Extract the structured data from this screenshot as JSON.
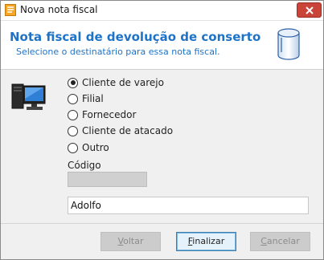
{
  "window": {
    "title": "Nova nota fiscal",
    "close_label": "Fechar"
  },
  "header": {
    "title": "Nota fiscal de devolução de conserto",
    "subtitle": "Selecione o destinatário para essa nota fiscal.",
    "icon": "cylinder-icon",
    "accent_color": "#1f73c7"
  },
  "recipient_options": [
    {
      "label": "Cliente de varejo",
      "checked": true
    },
    {
      "label": "Filial",
      "checked": false
    },
    {
      "label": "Fornecedor",
      "checked": false
    },
    {
      "label": "Cliente de atacado",
      "checked": false
    },
    {
      "label": "Outro",
      "checked": false
    }
  ],
  "codigo": {
    "label": "Código",
    "value": ""
  },
  "name_field": {
    "value": "Adolfo"
  },
  "buttons": {
    "back": "Voltar",
    "finish": "Finalizar",
    "cancel": "Cancelar"
  },
  "icons": {
    "app": "invoice-app-icon",
    "computer": "computer-icon"
  }
}
